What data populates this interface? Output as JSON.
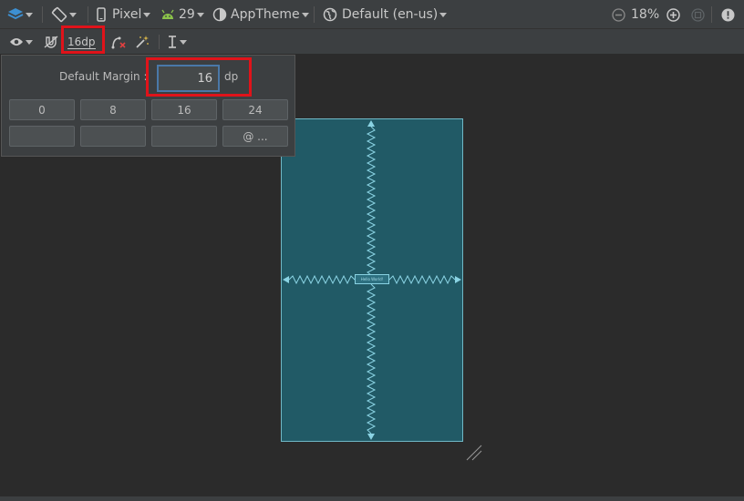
{
  "toolbar": {
    "device": "Pixel",
    "api_level": "29",
    "theme": "AppTheme",
    "locale": "Default (en-us)",
    "zoom": "18%"
  },
  "toolbar2": {
    "default_margin": "16dp"
  },
  "margin_popup": {
    "label": "Default Margin :",
    "value": "16",
    "unit": "dp",
    "options": [
      "0",
      "8",
      "16",
      "24"
    ],
    "custom": "@ ..."
  },
  "canvas": {
    "textview": "Hello World!"
  }
}
